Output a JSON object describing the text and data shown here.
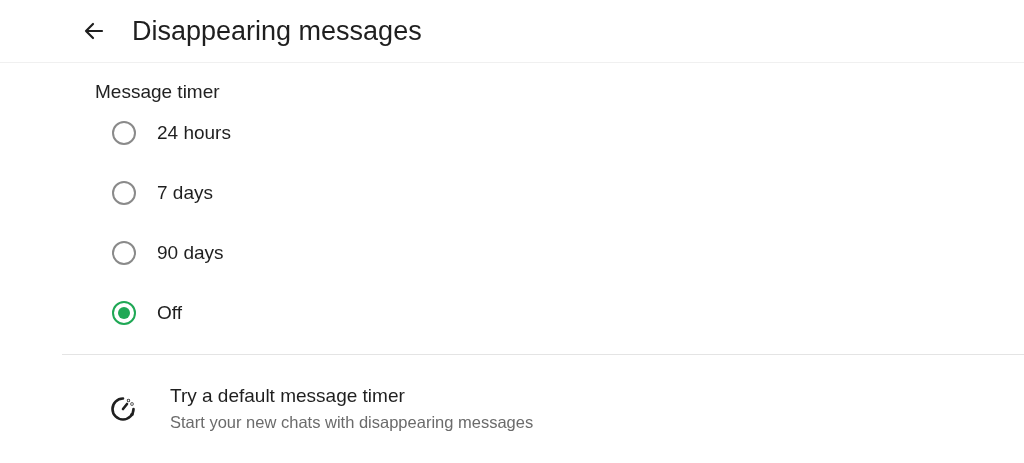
{
  "header": {
    "title": "Disappearing messages"
  },
  "section": {
    "title": "Message timer"
  },
  "options": [
    {
      "label": "24 hours",
      "selected": false
    },
    {
      "label": "7 days",
      "selected": false
    },
    {
      "label": "90 days",
      "selected": false
    },
    {
      "label": "Off",
      "selected": true
    }
  ],
  "default_timer": {
    "title": "Try a default message timer",
    "subtitle": "Start your new chats with disappearing messages"
  }
}
